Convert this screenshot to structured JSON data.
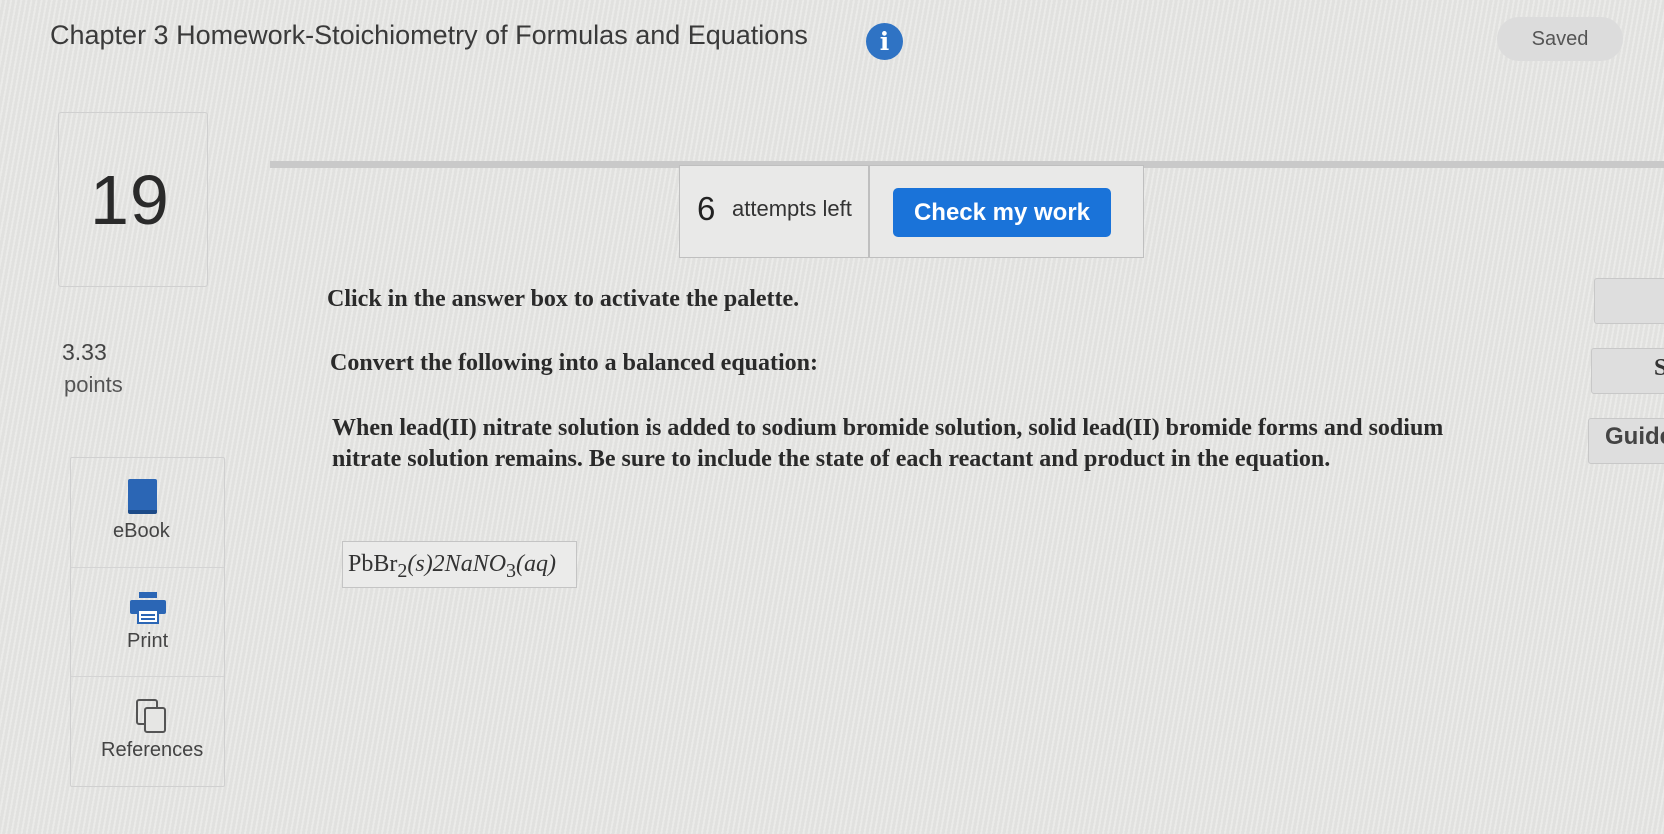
{
  "header": {
    "title": "Chapter 3 Homework-Stoichiometry of Formulas and Equations",
    "info_icon": "info-icon",
    "saved_label": "Saved"
  },
  "question": {
    "number": "19",
    "points_value": "3.33",
    "points_label": "points",
    "attempts_count": "6",
    "attempts_label": "attempts left",
    "check_button_label": "Check my work",
    "instruction": "Click in the answer box to activate the palette.",
    "prompt": "Convert the following into a balanced equation:",
    "body": "When lead(II) nitrate solution is added to sodium bromide solution, solid lead(II) bromide forms and sodium nitrate solution remains. Be sure to include the state of each reactant and product in the equation.",
    "answer": {
      "part1": "PbBr",
      "part1_sub": "2",
      "part2": "(s)2NaNO",
      "part2_sub": "3",
      "part3": "(aq)"
    }
  },
  "tools": {
    "ebook_label": "eBook",
    "ebook_icon": "book-icon",
    "print_label": "Print",
    "print_icon": "printer-icon",
    "references_label": "References",
    "references_icon": "copy-documents-icon"
  },
  "right_panel": {
    "button2_label": "S",
    "guide_label": "Guide"
  },
  "colors": {
    "accent": "#1a73d9",
    "info_icon": "#2f73c4"
  }
}
